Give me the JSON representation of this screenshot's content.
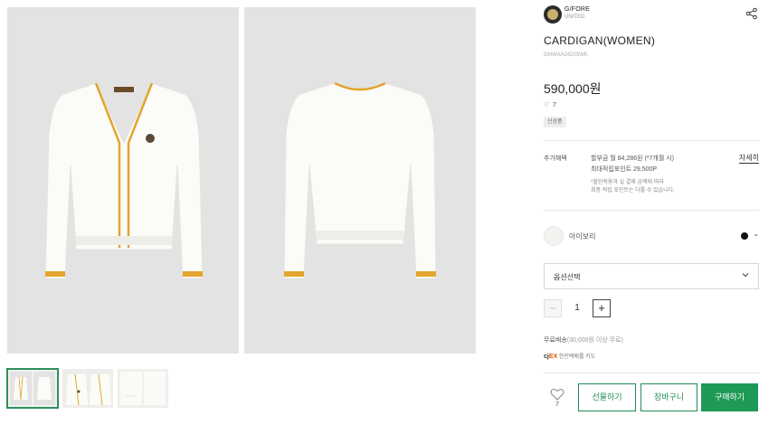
{
  "brand": {
    "name": "G/FORE",
    "sub": "UNITED"
  },
  "product": {
    "title": "CARDIGAN(WOMEN)",
    "code": "GNWAA24203WK",
    "price": "590,000원",
    "likes": "7",
    "badge": "신상품"
  },
  "benefit": {
    "label": "추가혜택",
    "line1": "할부금 월 84,286원 (*7개월 시)",
    "line2": "최대적립포인트 29,500P",
    "note1": "*할인적용과 실 결제 금액에 따라",
    "note2": "최종 적립 포인트는 다를 수 있습니다.",
    "detail_link": "자세히"
  },
  "color": {
    "name": "아이보리"
  },
  "option": {
    "placeholder": "옵션선택"
  },
  "quantity": {
    "value": "1",
    "minus": "−",
    "plus": "+"
  },
  "shipping": {
    "text": "무료배송",
    "condition": "(30,000원 이상 무료)"
  },
  "courier": {
    "logo_main": "cj",
    "logo_accent": "EX",
    "text": "한진택배를 키도"
  },
  "wishlist": {
    "count": "7"
  },
  "buttons": {
    "gift": "선물하기",
    "cart": "장바구니",
    "buy": "구매하기"
  },
  "colors": {
    "accent": "#1e9a56",
    "trim": "#e2a52e",
    "bg": "#e4e3e3"
  },
  "icons": {
    "share": "share-icon",
    "heart": "heart-icon",
    "chevron": "chevron-down-icon",
    "logo": "brand-logo-icon"
  }
}
